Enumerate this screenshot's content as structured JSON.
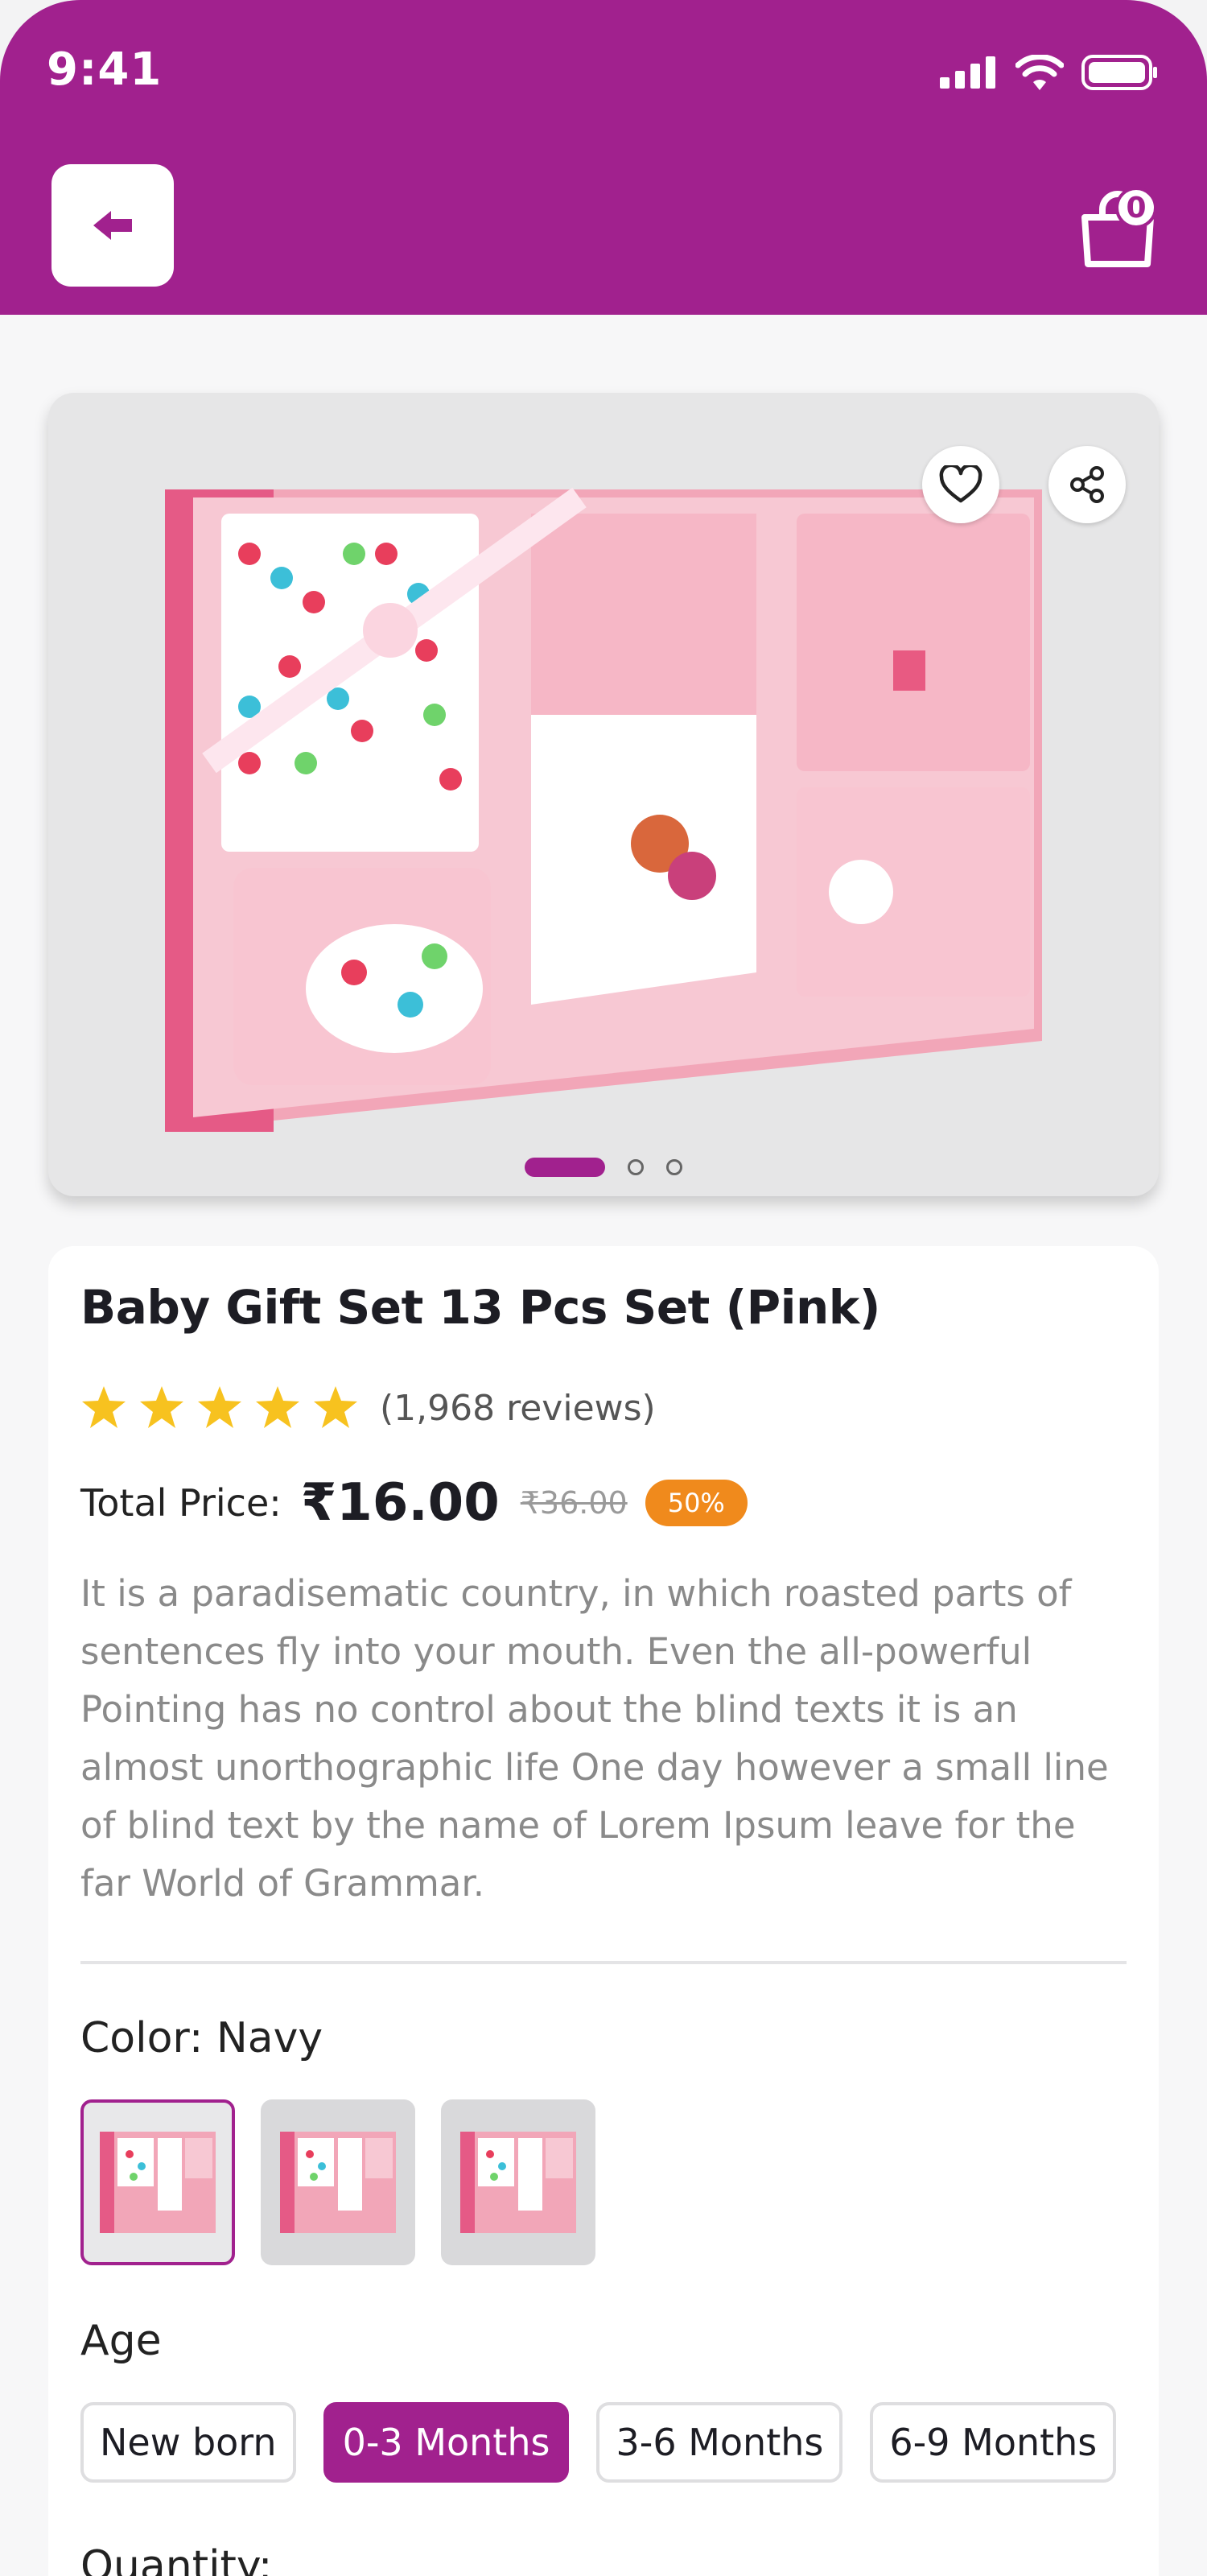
{
  "status_bar": {
    "time": "9:41"
  },
  "header": {
    "cart_count": "0"
  },
  "product": {
    "title": "Baby Gift Set 13 Pcs Set (Pink)",
    "rating": 5,
    "reviews": "(1,968 reviews)",
    "price_label": "Total Price:",
    "price": "₹16.00",
    "old_price": "₹36.00",
    "discount": "50%",
    "description": "It is a paradisematic country, in which roasted parts of sentences fly into your mouth. Even the all-powerful Pointing has no control about the blind texts it is an almost unorthographic life One day however a small line of blind text by the name of Lorem Ipsum leave for the far World of Grammar.",
    "color_label": "Color: Navy",
    "age_label": "Age",
    "ages": [
      "New born",
      "0-3 Months",
      "3-6 Months",
      "6-9 Months"
    ],
    "selected_age": "0-3 Months",
    "quantity_label": "Quantity:"
  },
  "gallery": {
    "pages": 3,
    "current_page": 1
  },
  "colors": {
    "accent": "#a1218e",
    "badge": "#f08a1c",
    "star": "#f7c21f"
  }
}
